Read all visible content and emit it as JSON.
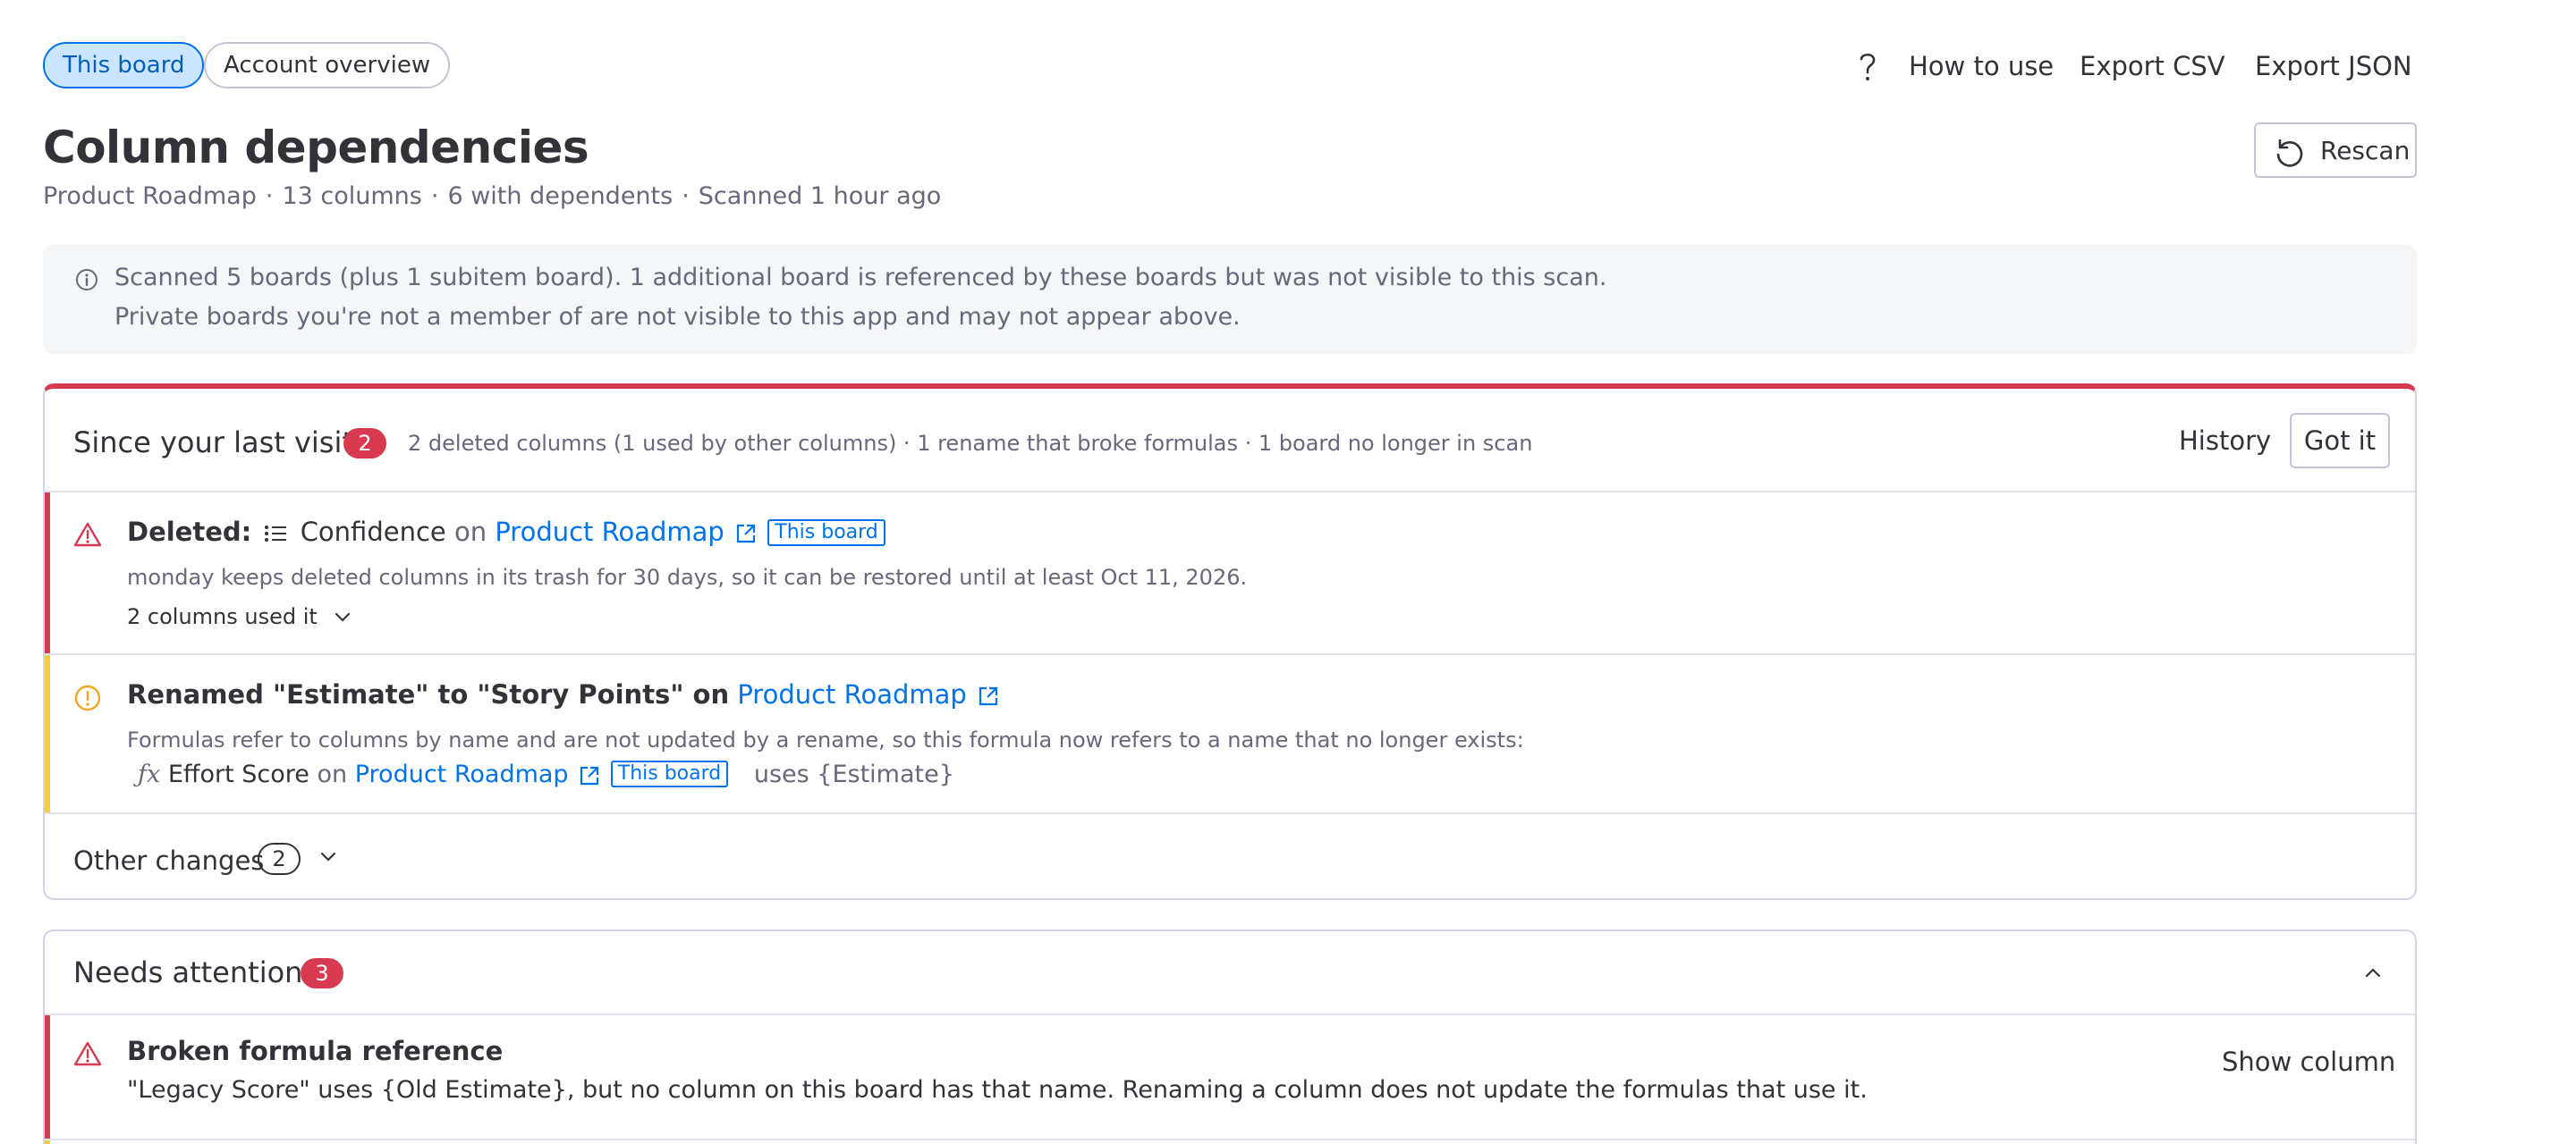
{
  "tabs": [
    {
      "label": "This board",
      "active": true
    },
    {
      "label": "Account overview",
      "active": false
    }
  ],
  "toolbar": {
    "how_to_use": "How to use",
    "export_csv": "Export CSV",
    "export_json": "Export JSON"
  },
  "header": {
    "title": "Column dependencies",
    "meta": [
      "Product Roadmap",
      "13 columns",
      "6 with dependents",
      "Scanned 1 hour ago"
    ],
    "separator": "·",
    "rescan_label": "Rescan"
  },
  "info": {
    "line1": "Scanned 5 boards (plus 1 subitem board). 1 additional board is referenced by these boards but was not visible to this scan.",
    "line2": "Private boards you're not a member of are not visible to this app and may not appear above."
  },
  "since_last_visit": {
    "title": "Since your last visit",
    "count": "2",
    "summary": "2 deleted columns (1 used by other columns) · 1 rename that broke formulas · 1 board no longer in scan",
    "history_label": "History",
    "got_it_label": "Got it",
    "deleted": {
      "prefix": "Deleted:",
      "column": "Confidence",
      "on": "on",
      "board": "Product Roadmap",
      "tag": "This board",
      "note": "monday keeps deleted columns in its trash for 30 days, so it can be restored until at least Oct 11, 2026.",
      "used_by": "2 columns used it"
    },
    "renamed": {
      "text": "Renamed \"Estimate\" to \"Story Points\" on",
      "board": "Product Roadmap",
      "note": "Formulas refer to columns by name and are not updated by a rename, so this formula now refers to a name that no longer exists:",
      "formula_column": "Effort Score",
      "on": "on",
      "formula_board": "Product Roadmap",
      "tag": "This board",
      "uses": "uses {Estimate}"
    },
    "other_changes": {
      "label": "Other changes",
      "count": "2"
    }
  },
  "needs_attention": {
    "title": "Needs attention",
    "count": "3",
    "items": [
      {
        "title": "Broken formula reference",
        "description": "\"Legacy Score\" uses {Old Estimate}, but no column on this board has that name. Renaming a column does not update the formulas that use it.",
        "action": "Show column"
      }
    ]
  },
  "colors": {
    "accent": "#0073ea",
    "danger": "#d83a52",
    "warning": "#fdab3d",
    "text": "#323338",
    "muted": "#676879"
  }
}
